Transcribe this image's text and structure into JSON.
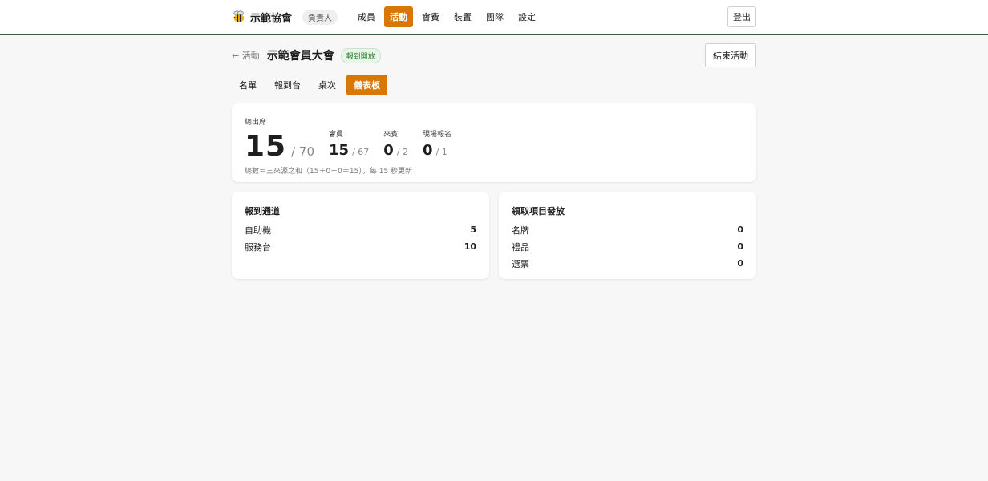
{
  "brand": {
    "name": "示範協會",
    "role": "負責人"
  },
  "nav": [
    {
      "label": "成員",
      "active": false
    },
    {
      "label": "活動",
      "active": true
    },
    {
      "label": "會費",
      "active": false
    },
    {
      "label": "裝置",
      "active": false
    },
    {
      "label": "團隊",
      "active": false
    },
    {
      "label": "設定",
      "active": false
    }
  ],
  "logout_label": "登出",
  "page": {
    "back_label": "← 活動",
    "title": "示範會員大會",
    "status": "報到開放",
    "end_button": "結束活動"
  },
  "tabs": [
    {
      "label": "名單",
      "active": false
    },
    {
      "label": "報到台",
      "active": false
    },
    {
      "label": "桌次",
      "active": false
    },
    {
      "label": "儀表板",
      "active": true
    }
  ],
  "stats": {
    "total_label": "總出席",
    "total": "15",
    "total_den": "/ 70",
    "members_label": "會員",
    "members": "15",
    "members_den": "/ 67",
    "guests_label": "來賓",
    "guests": "0",
    "guests_den": "/ 2",
    "walkin_label": "現場報名",
    "walkin": "0",
    "walkin_den": "/ 1",
    "note": "總數＝三來源之和（15＋0＋0＝15），每 15 秒更新"
  },
  "channels": {
    "title": "報到通道",
    "rows": [
      {
        "label": "自助機",
        "value": "5"
      },
      {
        "label": "服務台",
        "value": "10"
      }
    ]
  },
  "items": {
    "title": "領取項目發放",
    "rows": [
      {
        "label": "名牌",
        "value": "0"
      },
      {
        "label": "禮品",
        "value": "0"
      },
      {
        "label": "選票",
        "value": "0"
      }
    ]
  },
  "colors": {
    "accent": "#d97706",
    "topbar_border": "#3d5a3d"
  }
}
